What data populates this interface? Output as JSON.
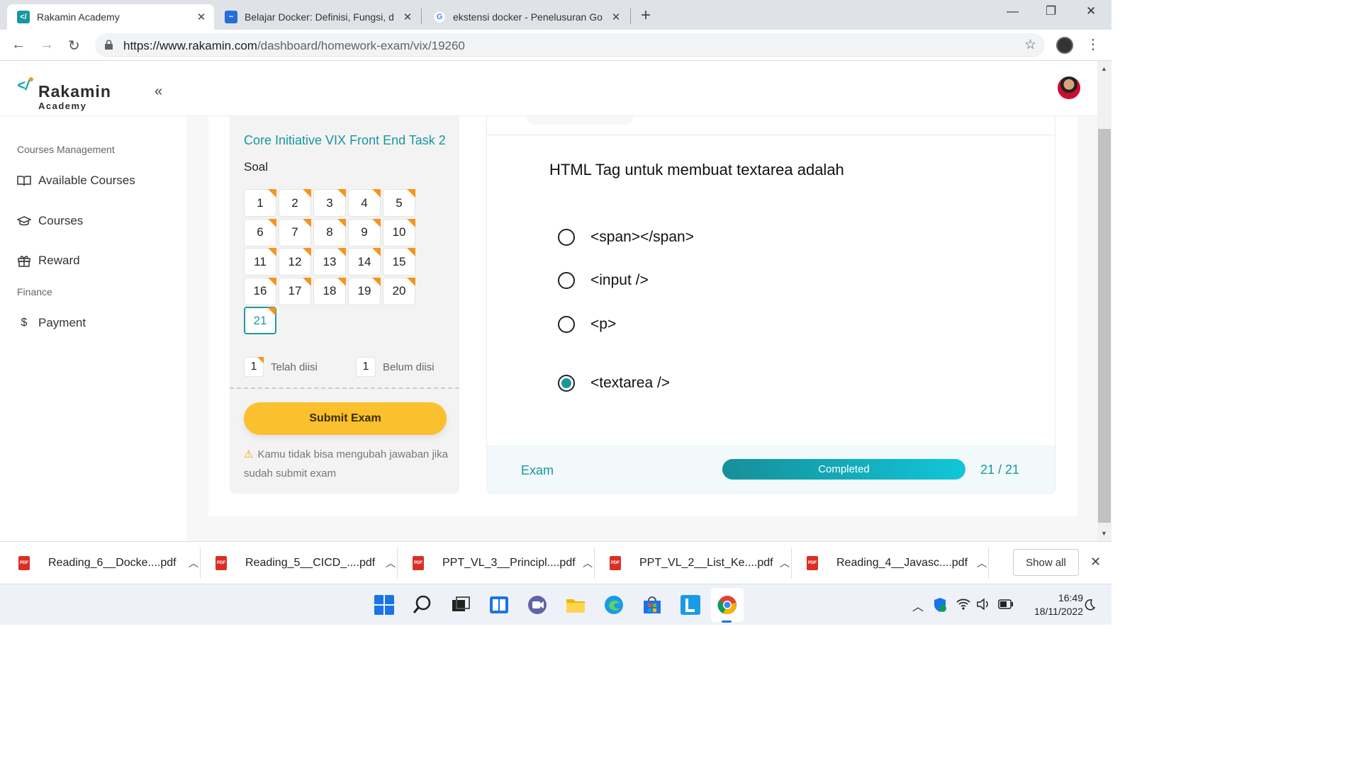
{
  "browser": {
    "tabs": [
      {
        "title": "Rakamin Academy",
        "icon": "rakamin-favicon"
      },
      {
        "title": "Belajar Docker: Definisi, Fungsi, d",
        "icon": "blog-favicon"
      },
      {
        "title": "ekstensi docker - Penelusuran Go",
        "icon": "google-favicon"
      }
    ],
    "url_host": "https://www.rakamin.com",
    "url_path": "/dashboard/homework-exam/vix/19260"
  },
  "app": {
    "logo_name": "Rakamin",
    "logo_sub": "Academy",
    "sidebar": {
      "section1": "Courses Management",
      "items1": [
        {
          "label": "Available Courses",
          "icon": "book-icon"
        },
        {
          "label": "Courses",
          "icon": "graduation-cap-icon"
        },
        {
          "label": "Reward",
          "icon": "gift-icon"
        }
      ],
      "section2": "Finance",
      "items2": [
        {
          "label": "Payment",
          "icon": "dollar-icon"
        }
      ]
    },
    "exam": {
      "course_title": "Core Initiative VIX Front End Task 2",
      "soal_label": "Soal",
      "questions": [
        "1",
        "2",
        "3",
        "4",
        "5",
        "6",
        "7",
        "8",
        "9",
        "10",
        "11",
        "12",
        "13",
        "14",
        "15",
        "16",
        "17",
        "18",
        "19",
        "20",
        "21"
      ],
      "current_question": "21",
      "legend_filled_count": "1",
      "legend_filled_label": "Telah diisi",
      "legend_empty_count": "1",
      "legend_empty_label": "Belum diisi",
      "submit_label": "Submit Exam",
      "warning": "Kamu tidak bisa mengubah jawaban jika sudah submit exam",
      "question_text": "HTML Tag untuk membuat textarea adalah",
      "options": [
        "<span></span>",
        "<input />",
        "<p>",
        "<textarea />"
      ],
      "selected_option": 3,
      "footer_label": "Exam",
      "progress_label": "Completed",
      "progress_fraction": 1.0,
      "progress_count": "21 / 21"
    }
  },
  "downloads": {
    "files": [
      "Reading_6__Docke....pdf",
      "Reading_5__CICD_....pdf",
      "PPT_VL_3__Principl....pdf",
      "PPT_VL_2__List_Ke....pdf",
      "Reading_4__Javasc....pdf"
    ],
    "show_all": "Show all"
  },
  "taskbar": {
    "time": "16:49",
    "date": "18/11/2022"
  },
  "colors": {
    "accent": "#17979f",
    "submit": "#fbc02d",
    "corner": "#f7941d"
  }
}
